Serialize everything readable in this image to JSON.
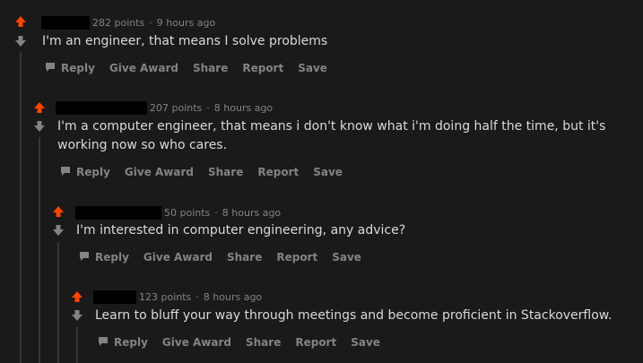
{
  "colors": {
    "upvote": "#ff4500",
    "downvote": "#818384",
    "background": "#1a1a1b",
    "text": "#d7dadc",
    "muted": "#818384"
  },
  "comments": [
    {
      "points": "282 points",
      "age": "9 hours ago",
      "separator": "·",
      "text": "I'm an engineer, that means I solve problems",
      "actions": [
        "Reply",
        "Give Award",
        "Share",
        "Report",
        "Save"
      ]
    },
    {
      "points": "207 points",
      "age": "8 hours ago",
      "separator": "·",
      "text": "I'm a computer engineer, that means i don't know what i'm doing half the time, but it's working now so who cares.",
      "actions": [
        "Reply",
        "Give Award",
        "Share",
        "Report",
        "Save"
      ]
    },
    {
      "points": "50 points",
      "age": "8 hours ago",
      "separator": "·",
      "text": "I'm interested in computer engineering, any advice?",
      "actions": [
        "Reply",
        "Give Award",
        "Share",
        "Report",
        "Save"
      ]
    },
    {
      "points": "123 points",
      "age": "8 hours ago",
      "separator": "·",
      "text": "Learn to bluff your way through meetings and become proficient in Stackoverflow.",
      "actions": [
        "Reply",
        "Give Award",
        "Share",
        "Report",
        "Save"
      ]
    }
  ]
}
